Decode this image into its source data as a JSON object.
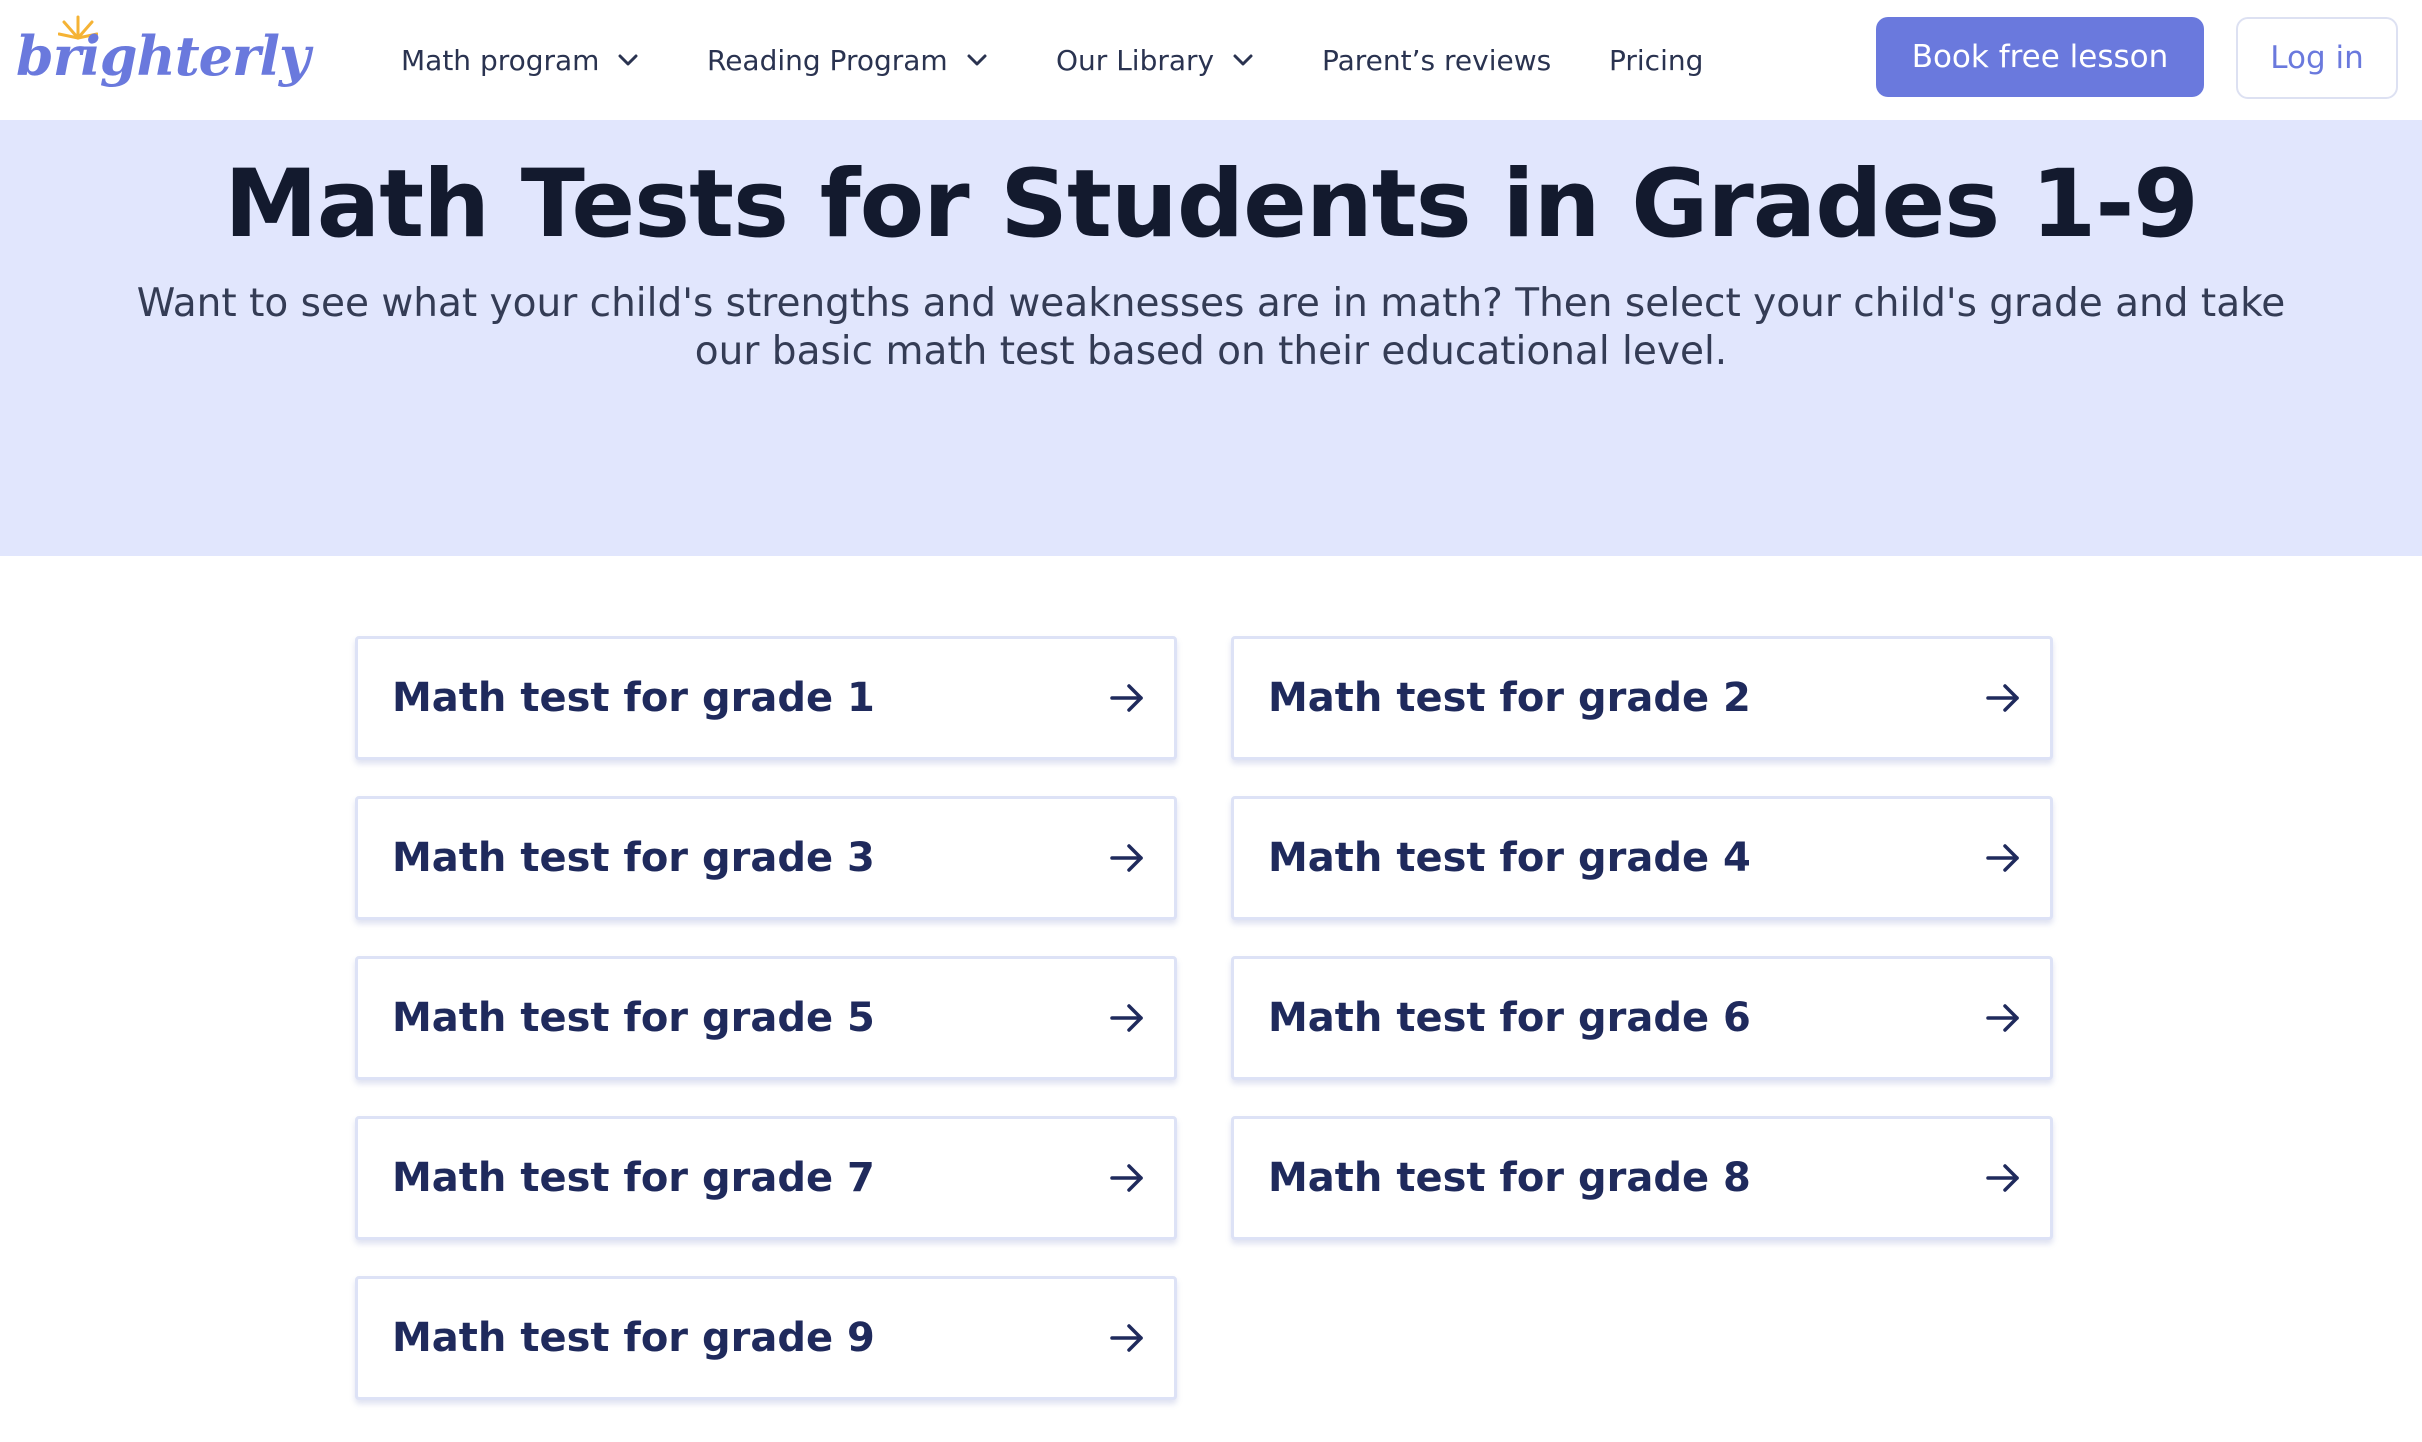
{
  "brand": {
    "logo_text": "brighterly",
    "logo_color": "#6a79dd",
    "sun_color": "#f5b335"
  },
  "nav": {
    "items": [
      {
        "label": "Math program",
        "has_dropdown": true
      },
      {
        "label": "Reading Program",
        "has_dropdown": true
      },
      {
        "label": "Our Library",
        "has_dropdown": true
      },
      {
        "label": "Parent’s reviews",
        "has_dropdown": false
      },
      {
        "label": "Pricing",
        "has_dropdown": false
      }
    ]
  },
  "actions": {
    "book_label": "Book free lesson",
    "login_label": "Log in",
    "accent_color": "#6a79dd"
  },
  "hero": {
    "title": "Math Tests for Students in Grades 1-9",
    "subtitle": "Want to see what your child's strengths and weaknesses are in math? Then select your child's grade and take our basic math test based on their educational level.",
    "background": "#e1e6fd"
  },
  "grades": {
    "items": [
      {
        "label": "Math test for grade 1"
      },
      {
        "label": "Math test for grade 2"
      },
      {
        "label": "Math test for grade 3"
      },
      {
        "label": "Math test for grade 4"
      },
      {
        "label": "Math test for grade 5"
      },
      {
        "label": "Math test for grade 6"
      },
      {
        "label": "Math test for grade 7"
      },
      {
        "label": "Math test for grade 8"
      },
      {
        "label": "Math test for grade 9"
      }
    ],
    "arrow_icon": "arrow-right-icon"
  }
}
